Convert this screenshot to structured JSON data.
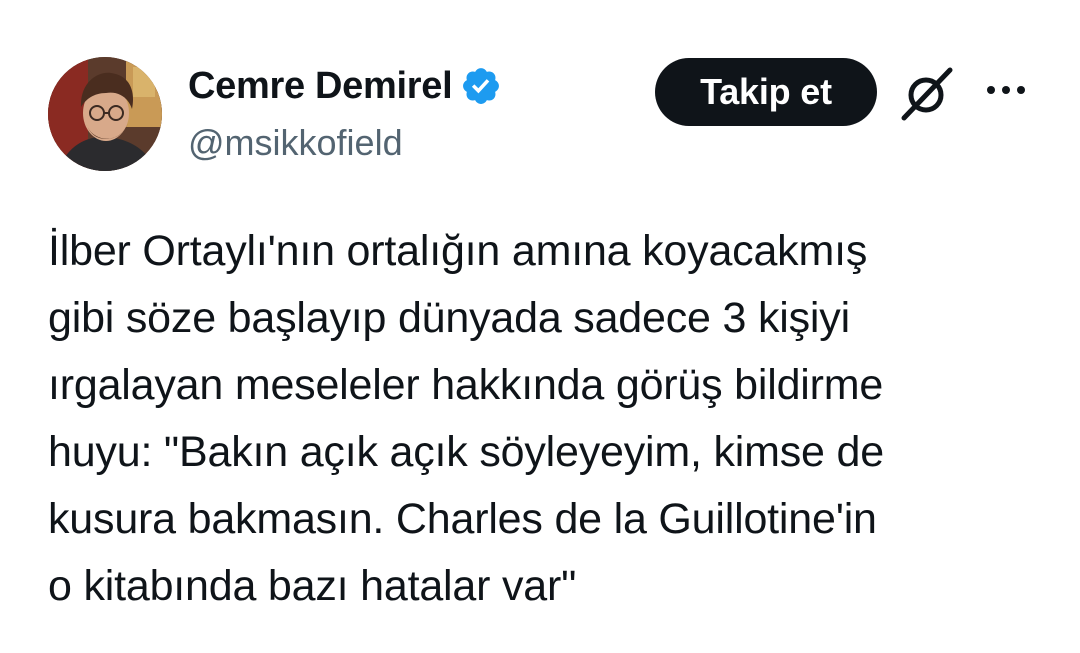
{
  "author": {
    "display_name": "Cemre Demirel",
    "handle": "@msikkofield",
    "verified": true,
    "verified_color": "#1d9bf0"
  },
  "actions": {
    "follow_label": "Takip et",
    "grok_icon": "grok-icon",
    "more_icon": "more-icon"
  },
  "tweet": {
    "text": "İlber Ortaylı'nın ortalığın amına koyacakmış\ngibi söze başlayıp dünyada sadece 3 kişiyi\nırgalayan meseleler hakkında görüş bildirme\nhuyu: \"Bakın açık açık söyleyeyim, kimse de\nkusura bakmasın. Charles de la Guillotine'in\no kitabında bazı hatalar var\""
  },
  "colors": {
    "text": "#0f1419",
    "secondary": "#536471",
    "button_bg": "#0f1419",
    "button_text": "#ffffff"
  }
}
